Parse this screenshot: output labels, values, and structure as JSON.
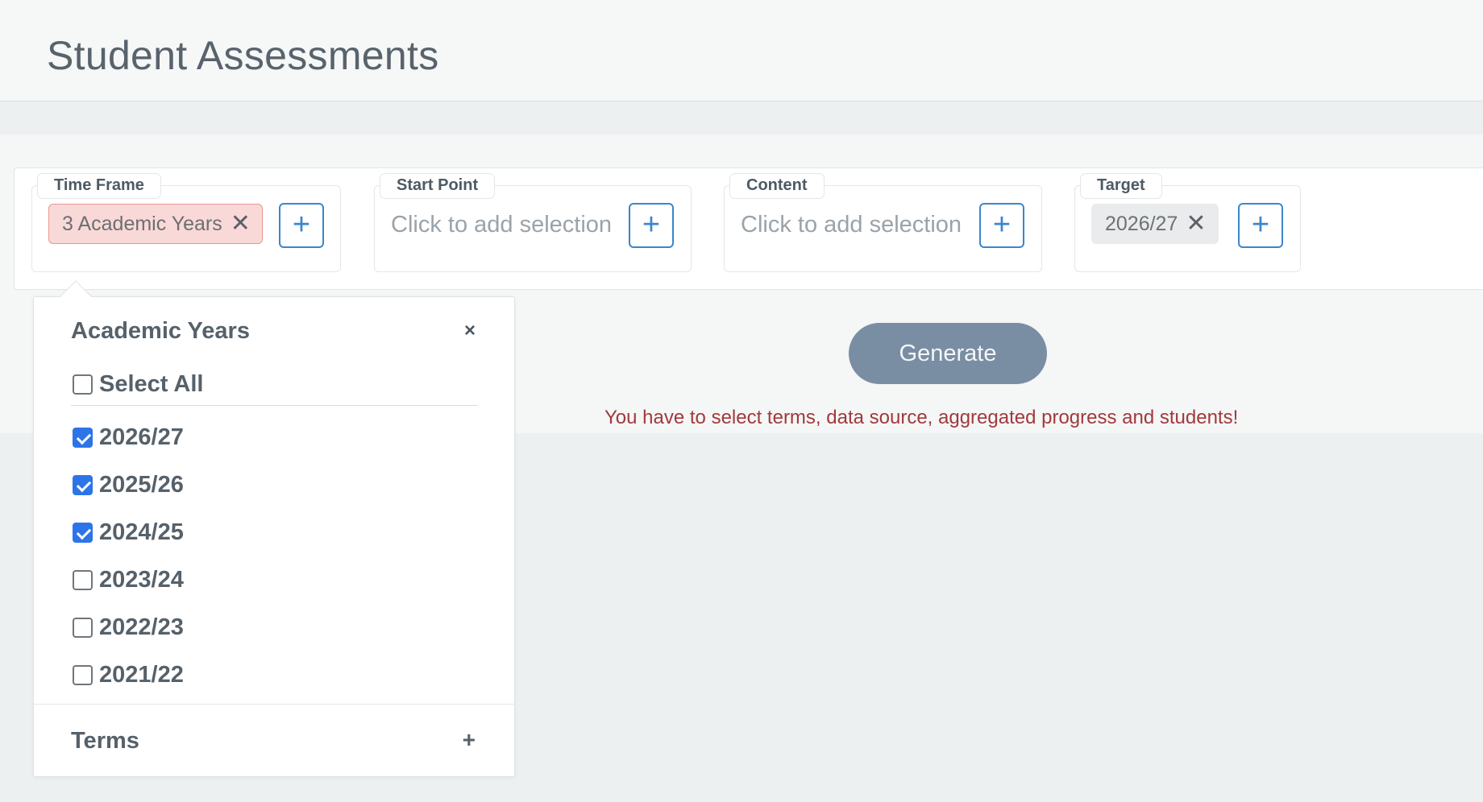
{
  "header": {
    "title": "Student Assessments"
  },
  "filters": {
    "time_frame": {
      "label": "Time Frame",
      "chip": "3 Academic Years",
      "chip_remove": "✕",
      "add": "+"
    },
    "start_point": {
      "label": "Start Point",
      "placeholder": "Click to add selection",
      "add": "+"
    },
    "content": {
      "label": "Content",
      "placeholder": "Click to add selection",
      "add": "+"
    },
    "target": {
      "label": "Target",
      "chip": "2026/27",
      "chip_remove": "✕",
      "add": "+"
    }
  },
  "dropdown": {
    "title": "Academic Years",
    "close": "×",
    "select_all": {
      "label": "Select All",
      "checked": false
    },
    "years": [
      {
        "label": "2026/27",
        "checked": true
      },
      {
        "label": "2025/26",
        "checked": true
      },
      {
        "label": "2024/25",
        "checked": true
      },
      {
        "label": "2023/24",
        "checked": false
      },
      {
        "label": "2022/23",
        "checked": false
      },
      {
        "label": "2021/22",
        "checked": false
      }
    ],
    "terms": {
      "label": "Terms",
      "expand": "+"
    }
  },
  "actions": {
    "generate": "Generate",
    "error": "You have to select terms, data source, aggregated progress and students!"
  },
  "colors": {
    "accent": "#3b86cc",
    "checkbox_checked": "#2d74e8",
    "error": "#a2393b",
    "generate_bg": "#7a8ea3",
    "chip_red_bg": "#f9d9d7",
    "chip_red_border": "#e89792"
  }
}
